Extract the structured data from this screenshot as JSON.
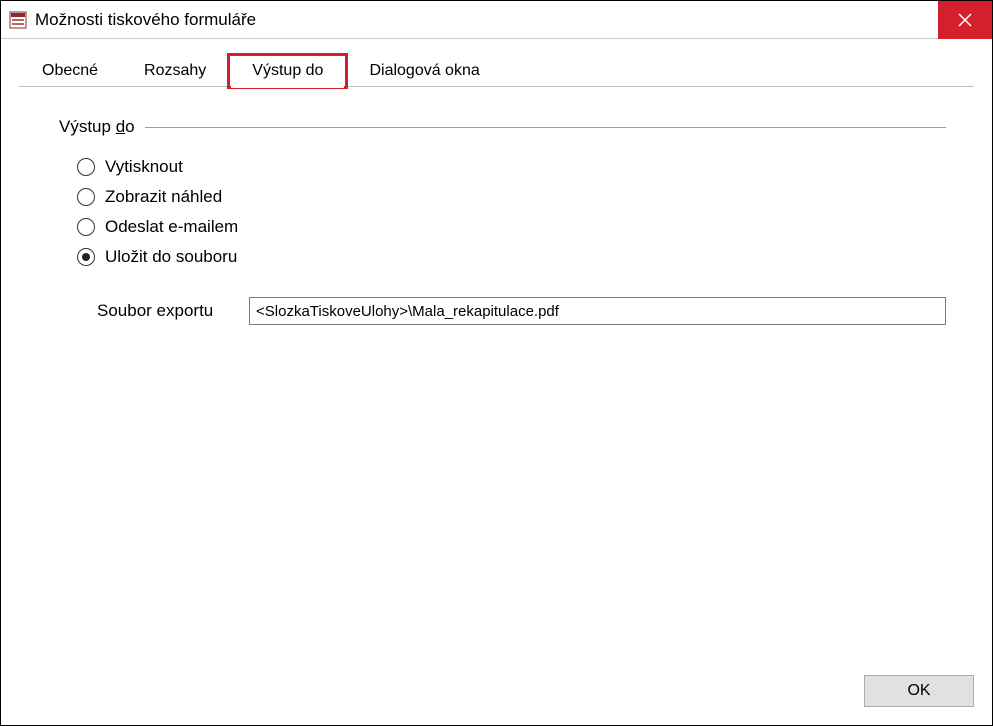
{
  "window": {
    "title": "Možnosti tiskového formuláře"
  },
  "tabs": {
    "items": [
      {
        "label": "Obecné",
        "active": false,
        "highlight": false
      },
      {
        "label": "Rozsahy",
        "active": false,
        "highlight": false
      },
      {
        "label": "Výstup do",
        "active": true,
        "highlight": true
      },
      {
        "label": "Dialogová okna",
        "active": false,
        "highlight": false
      }
    ]
  },
  "section": {
    "title_prefix": "Výstup ",
    "title_underlined": "d",
    "title_suffix": "o"
  },
  "radios": {
    "items": [
      {
        "label": "Vytisknout",
        "checked": false
      },
      {
        "label": "Zobrazit náhled",
        "checked": false
      },
      {
        "label": "Odeslat e-mailem",
        "checked": false
      },
      {
        "label": "Uložit do souboru",
        "checked": true
      }
    ]
  },
  "exportField": {
    "label": "Soubor exportu",
    "value": "<SlozkaTiskoveUlohy>\\Mala_rekapitulace.pdf"
  },
  "footer": {
    "ok_label": "OK"
  }
}
